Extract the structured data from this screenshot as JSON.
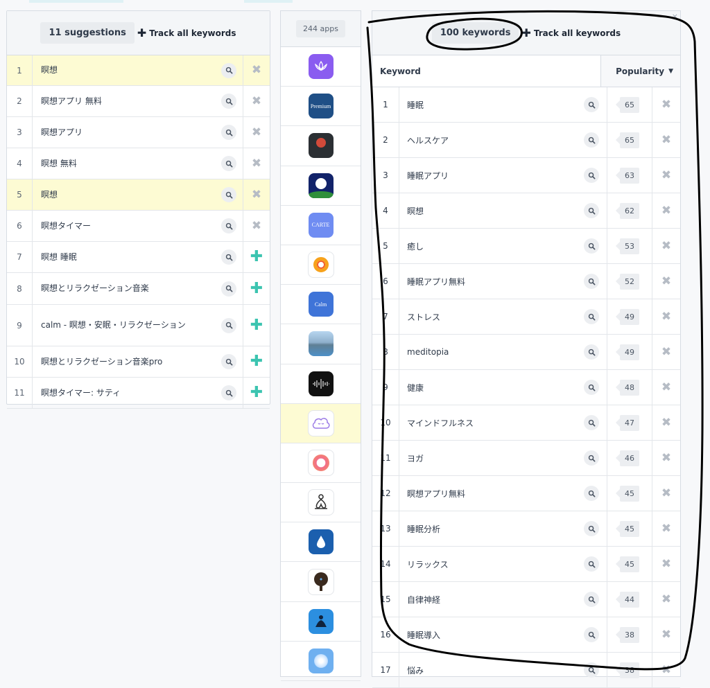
{
  "suggestions": {
    "count_label": "11 suggestions",
    "track_all_label": "Track all keywords",
    "items": [
      {
        "num": "1",
        "keyword": "瞑想",
        "highlighted": true,
        "action": "remove"
      },
      {
        "num": "2",
        "keyword": "瞑想アプリ 無料",
        "highlighted": false,
        "action": "remove"
      },
      {
        "num": "3",
        "keyword": "瞑想アプリ",
        "highlighted": false,
        "action": "remove"
      },
      {
        "num": "4",
        "keyword": "瞑想 無料",
        "highlighted": false,
        "action": "remove"
      },
      {
        "num": "5",
        "keyword": "瞑想",
        "highlighted": true,
        "action": "remove"
      },
      {
        "num": "6",
        "keyword": "瞑想タイマー",
        "highlighted": false,
        "action": "remove"
      },
      {
        "num": "7",
        "keyword": "瞑想 睡眠",
        "highlighted": false,
        "action": "add"
      },
      {
        "num": "8",
        "keyword": "瞑想とリラクゼーション音楽",
        "highlighted": false,
        "action": "add"
      },
      {
        "num": "9",
        "keyword": "calm - 瞑想・安眠・リラクゼーション",
        "highlighted": false,
        "action": "add"
      },
      {
        "num": "10",
        "keyword": "瞑想とリラクゼーション音楽pro",
        "highlighted": false,
        "action": "add"
      },
      {
        "num": "11",
        "keyword": "瞑想タイマー: サティ",
        "highlighted": false,
        "action": "add"
      }
    ]
  },
  "apps": {
    "count_label": "244 apps",
    "items": [
      {
        "name": "lotus-app-icon",
        "bg": "#8a5cf0",
        "highlighted": false
      },
      {
        "name": "meditation-premium-app-icon",
        "bg": "#1f4f86",
        "highlighted": false,
        "text": "Premium"
      },
      {
        "name": "dark-portrait-app-icon",
        "bg": "#2b2f33",
        "highlighted": false
      },
      {
        "name": "moon-night-app-icon",
        "bg": "#12236a",
        "highlighted": false
      },
      {
        "name": "carte-app-icon",
        "bg": "#6f8cf2",
        "highlighted": false,
        "text": "CARTE"
      },
      {
        "name": "orange-ring-app-icon",
        "bg": "#ffffff",
        "highlighted": false
      },
      {
        "name": "calm-app-icon",
        "bg": "#3f74d8",
        "highlighted": false,
        "text": "Calm"
      },
      {
        "name": "mountain-lake-app-icon",
        "bg": "#6f9fcf",
        "highlighted": false
      },
      {
        "name": "sound-wave-app-icon",
        "bg": "#111111",
        "highlighted": false
      },
      {
        "name": "cloud-face-app-icon",
        "bg": "#ffffff",
        "highlighted": true
      },
      {
        "name": "pink-circle-app-icon",
        "bg": "#ffffff",
        "highlighted": false
      },
      {
        "name": "yoga-figure-app-icon",
        "bg": "#ffffff",
        "highlighted": false
      },
      {
        "name": "water-drop-app-icon",
        "bg": "#1b5fae",
        "highlighted": false
      },
      {
        "name": "tree-app-icon",
        "bg": "#ffffff",
        "highlighted": false
      },
      {
        "name": "meditating-person-app-icon",
        "bg": "#2c8fe0",
        "highlighted": false
      },
      {
        "name": "flower-app-icon",
        "bg": "#6fb0f0",
        "highlighted": false
      }
    ]
  },
  "keywords": {
    "count_label": "100 keywords",
    "track_all_label": "Track all keywords",
    "close_glyph": "×",
    "columns": {
      "keyword": "Keyword",
      "popularity": "Popularity"
    },
    "items": [
      {
        "num": "1",
        "keyword": "睡眠",
        "popularity": "65"
      },
      {
        "num": "2",
        "keyword": "ヘルスケア",
        "popularity": "65"
      },
      {
        "num": "3",
        "keyword": "睡眠アプリ",
        "popularity": "63"
      },
      {
        "num": "4",
        "keyword": "瞑想",
        "popularity": "62"
      },
      {
        "num": "5",
        "keyword": "癒し",
        "popularity": "53"
      },
      {
        "num": "6",
        "keyword": "睡眠アプリ無料",
        "popularity": "52"
      },
      {
        "num": "7",
        "keyword": "ストレス",
        "popularity": "49"
      },
      {
        "num": "8",
        "keyword": "meditopia",
        "popularity": "49"
      },
      {
        "num": "9",
        "keyword": "健康",
        "popularity": "48"
      },
      {
        "num": "10",
        "keyword": "マインドフルネス",
        "popularity": "47"
      },
      {
        "num": "11",
        "keyword": "ヨガ",
        "popularity": "46"
      },
      {
        "num": "12",
        "keyword": "瞑想アプリ無料",
        "popularity": "45"
      },
      {
        "num": "13",
        "keyword": "睡眠分析",
        "popularity": "45"
      },
      {
        "num": "14",
        "keyword": "リラックス",
        "popularity": "45"
      },
      {
        "num": "15",
        "keyword": "自律神経",
        "popularity": "44"
      },
      {
        "num": "16",
        "keyword": "睡眠導入",
        "popularity": "38"
      },
      {
        "num": "17",
        "keyword": "悩み",
        "popularity": "38"
      }
    ]
  },
  "colors": {
    "highlight": "#fdfbd3",
    "add": "#3cc4b0",
    "remove": "#b6bcc5",
    "annotation": "#000000"
  }
}
